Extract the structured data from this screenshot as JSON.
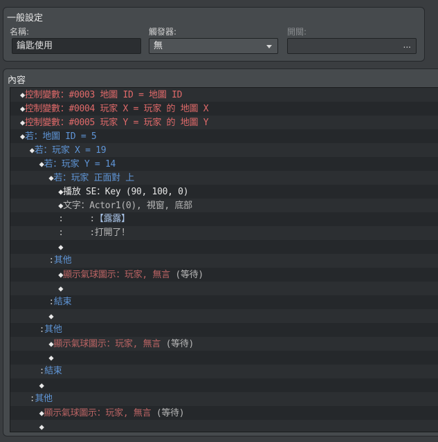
{
  "general": {
    "title": "一般設定",
    "name_label": "名稱:",
    "name_value": "鑰匙使用",
    "trigger_label": "觸發器:",
    "trigger_value": "無",
    "switch_label": "開關:",
    "switch_button": "..."
  },
  "content": {
    "title": "內容",
    "rows": [
      {
        "level": 0,
        "marker": "◆",
        "parts": [
          {
            "t": "控制變數：#0003 地圖 ID = 地圖 ID",
            "c": "red"
          }
        ]
      },
      {
        "level": 0,
        "marker": "◆",
        "parts": [
          {
            "t": "控制變數：#0004 玩家 X = 玩家 的 地圖 X",
            "c": "red"
          }
        ]
      },
      {
        "level": 0,
        "marker": "◆",
        "parts": [
          {
            "t": "控制變數：#0005 玩家 Y = 玩家 的 地圖 Y",
            "c": "red"
          }
        ]
      },
      {
        "level": 0,
        "marker": "◆",
        "parts": [
          {
            "t": "若：地圖 ID = 5",
            "c": "blue"
          }
        ]
      },
      {
        "level": 1,
        "marker": "◆",
        "parts": [
          {
            "t": "若：玩家 X = 19",
            "c": "blue"
          }
        ]
      },
      {
        "level": 2,
        "marker": "◆",
        "parts": [
          {
            "t": "若：玩家 Y = 14",
            "c": "blue"
          }
        ]
      },
      {
        "level": 3,
        "marker": "◆",
        "parts": [
          {
            "t": "若：玩家 正面對 上",
            "c": "blue"
          }
        ]
      },
      {
        "level": 4,
        "marker": "◆",
        "parts": [
          {
            "t": "播放 SE：Key (90, 100, 0)",
            "c": "white"
          }
        ]
      },
      {
        "level": 4,
        "marker": "◆",
        "parts": [
          {
            "t": "文字：Actor1(0), 視窗, 底部",
            "c": "gray"
          }
        ]
      },
      {
        "level": 4,
        "marker": ":",
        "parts": [
          {
            "t": "     :",
            "c": "gray"
          },
          {
            "t": "【露露】",
            "c": "pale"
          }
        ]
      },
      {
        "level": 4,
        "marker": ":",
        "parts": [
          {
            "t": "     :打開了！",
            "c": "gray"
          }
        ]
      },
      {
        "level": 4,
        "marker": "◆",
        "parts": []
      },
      {
        "level": 3,
        "marker": ":",
        "parts": [
          {
            "t": "其他",
            "c": "blue"
          }
        ]
      },
      {
        "level": 4,
        "marker": "◆",
        "parts": [
          {
            "t": "顯示氣球圖示：玩家, 無言",
            "c": "dred"
          },
          {
            "t": " (等待)",
            "c": "gray"
          }
        ]
      },
      {
        "level": 4,
        "marker": "◆",
        "parts": []
      },
      {
        "level": 3,
        "marker": ":",
        "parts": [
          {
            "t": "結束",
            "c": "blue"
          }
        ]
      },
      {
        "level": 3,
        "marker": "◆",
        "parts": []
      },
      {
        "level": 2,
        "marker": ":",
        "parts": [
          {
            "t": "其他",
            "c": "blue"
          }
        ]
      },
      {
        "level": 3,
        "marker": "◆",
        "parts": [
          {
            "t": "顯示氣球圖示：玩家, 無言",
            "c": "dred"
          },
          {
            "t": " (等待)",
            "c": "gray"
          }
        ]
      },
      {
        "level": 3,
        "marker": "◆",
        "parts": []
      },
      {
        "level": 2,
        "marker": ":",
        "parts": [
          {
            "t": "結束",
            "c": "blue"
          }
        ]
      },
      {
        "level": 2,
        "marker": "◆",
        "parts": []
      },
      {
        "level": 1,
        "marker": ":",
        "parts": [
          {
            "t": "其他",
            "c": "blue"
          }
        ]
      },
      {
        "level": 2,
        "marker": "◆",
        "parts": [
          {
            "t": "顯示氣球圖示：玩家, 無言",
            "c": "dred"
          },
          {
            "t": " (等待)",
            "c": "gray"
          }
        ]
      },
      {
        "level": 2,
        "marker": "◆",
        "parts": []
      }
    ]
  }
}
